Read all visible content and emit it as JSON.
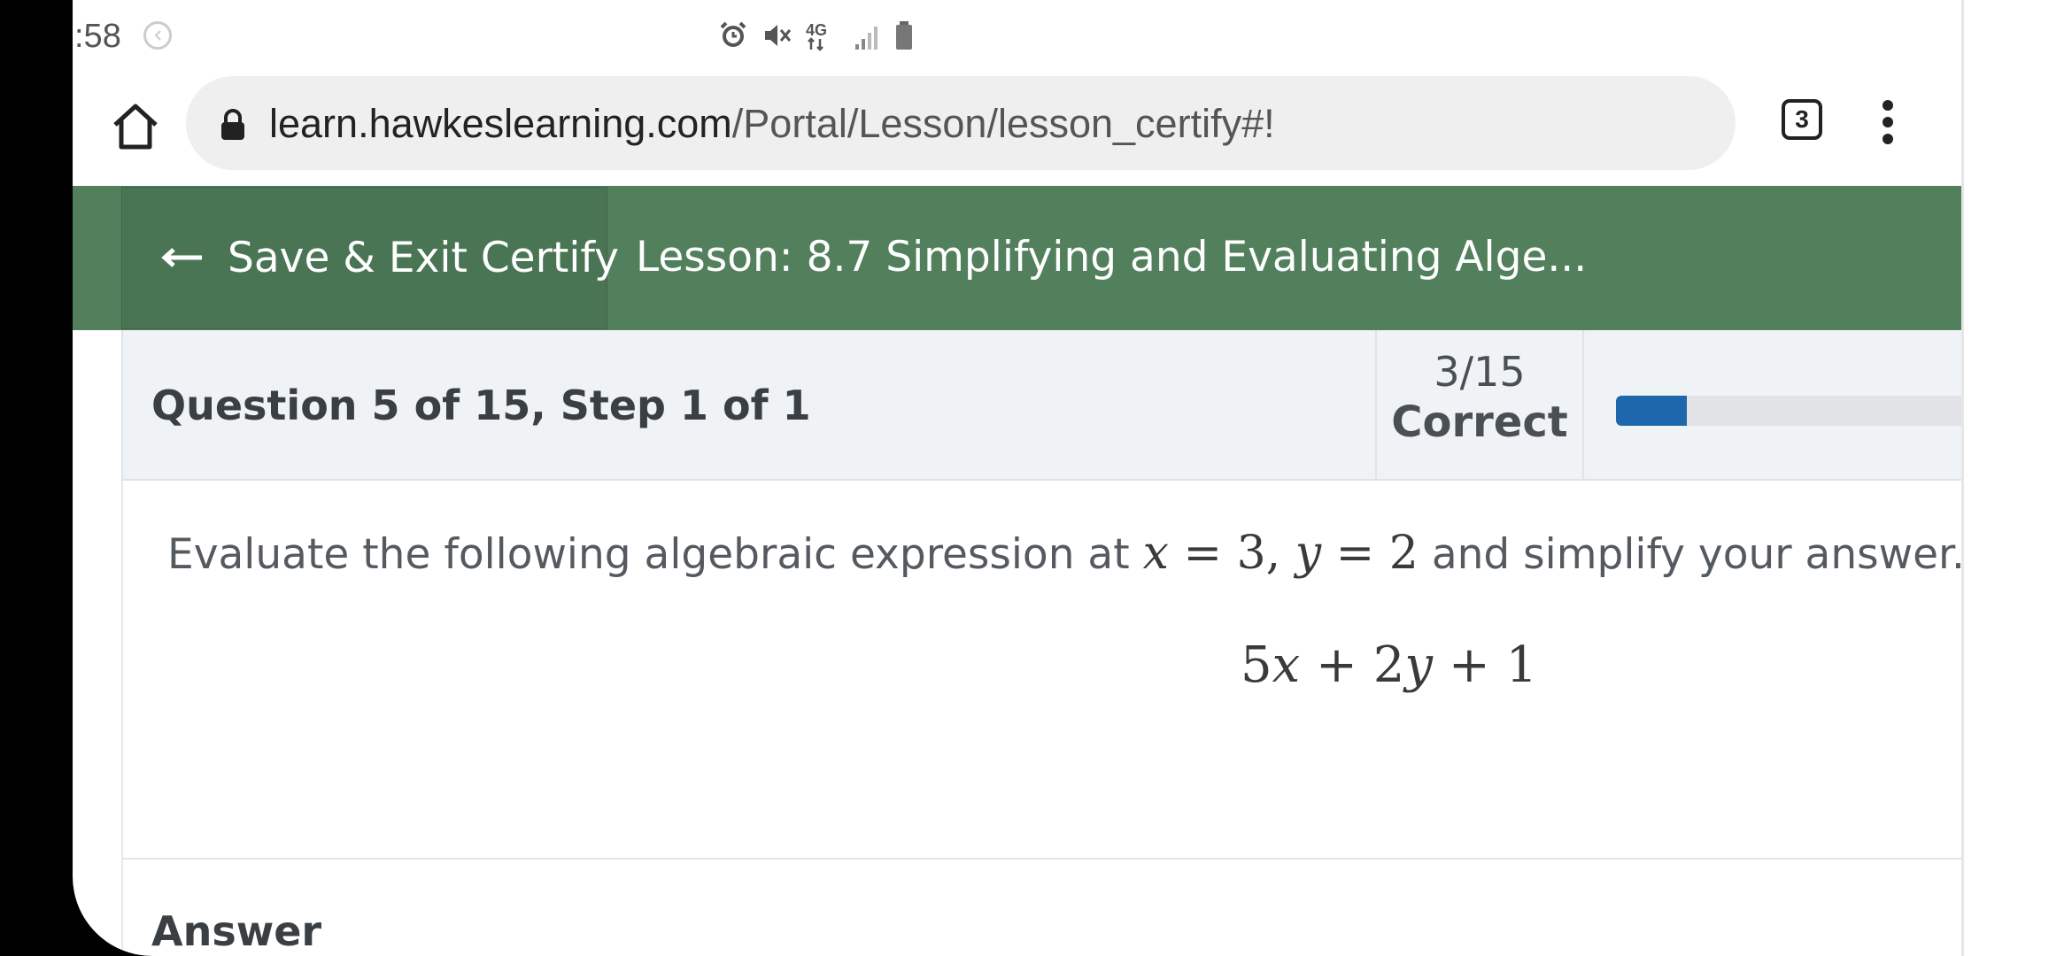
{
  "status_bar": {
    "time": ":58",
    "network": "4G"
  },
  "browser": {
    "url_domain": "learn.hawkeslearning.com",
    "url_path": "/Portal/Lesson/lesson_certify#!",
    "tab_count": "3"
  },
  "header": {
    "exit_label": "Save & Exit Certify",
    "lesson_title": "Lesson: 8.7 Simplifying and Evaluating Alge..."
  },
  "question": {
    "title": "Question 5 of 15, Step 1 of 1",
    "score": "3/15",
    "score_label": "Correct",
    "progress_fraction": 0.2,
    "prompt_before": "Evaluate the following algebraic expression at",
    "x_var": "x",
    "eq": "=",
    "x_value": "3,",
    "y_var": "y",
    "y_value": "2",
    "prompt_after": "and simplify your answer.",
    "expression": {
      "c1": "5",
      "v1": "x",
      "op1": "+",
      "c2": "2",
      "v2": "y",
      "op2": "+",
      "c3": "1"
    }
  },
  "answer": {
    "label": "Answer"
  },
  "colors": {
    "header_green": "#52805c",
    "progress_blue": "#1f67ad"
  }
}
